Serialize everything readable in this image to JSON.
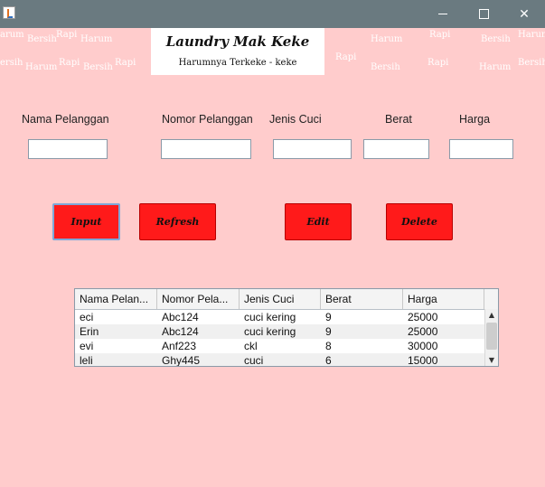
{
  "window": {
    "icon": "java-icon",
    "controls": {
      "minimize": "minimize-icon",
      "maximize": "maximize-icon",
      "close": "✕"
    }
  },
  "background_words": {
    "harum": "Harum",
    "bersih": "Bersih",
    "rapi": "Rapi",
    "harum_cut": "arum",
    "bersih_cut": "ersih"
  },
  "header": {
    "title": "Laundry Mak Keke",
    "subtitle": "Harumnya Terkeke - keke"
  },
  "form": {
    "labels": {
      "nama": "Nama Pelanggan",
      "nomor": "Nomor Pelanggan",
      "jenis": "Jenis Cuci",
      "berat": "Berat",
      "harga": "Harga"
    },
    "values": {
      "nama": "",
      "nomor": "",
      "jenis": "",
      "berat": "",
      "harga": ""
    }
  },
  "buttons": {
    "input": "Input",
    "refresh": "Refresh",
    "edit": "Edit",
    "delete": "Delete"
  },
  "table": {
    "headers": [
      "Nama Pelan...",
      "Nomor Pela...",
      "Jenis Cuci",
      "Berat",
      "Harga"
    ],
    "rows": [
      [
        "eci",
        "Abc124",
        "cuci kering",
        "9",
        "25000"
      ],
      [
        "Erin",
        "Abc124",
        "cuci kering",
        "9",
        "25000"
      ],
      [
        "evi",
        "Anf223",
        "ckl",
        "8",
        "30000"
      ],
      [
        "leli",
        "Ghy445",
        "cuci",
        "6",
        "15000"
      ]
    ]
  },
  "colors": {
    "background": "#ffcccc",
    "titlebar": "#6a7a80",
    "button": "#ff1a1a"
  }
}
